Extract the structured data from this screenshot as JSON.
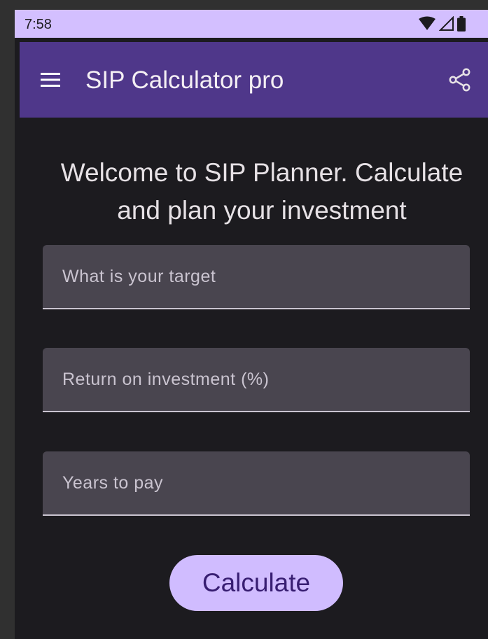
{
  "status_bar": {
    "time": "7:58",
    "icons": [
      "wifi-icon",
      "cellular-signal-icon",
      "battery-icon"
    ],
    "background": "#d3bfff"
  },
  "app_bar": {
    "title": "SIP Calculator pro",
    "menu_icon": "menu-icon",
    "share_icon": "share-icon",
    "background": "#4f378a"
  },
  "main": {
    "welcome_text": "Welcome to SIP Planner. Calculate and plan your investment",
    "fields": {
      "target": {
        "placeholder": "What is your target",
        "value": ""
      },
      "return": {
        "placeholder": "Return on investment (%)",
        "value": ""
      },
      "years": {
        "placeholder": "Years to pay",
        "value": ""
      }
    },
    "calculate_label": "Calculate"
  },
  "colors": {
    "surface": "#1c1b1f",
    "field_fill": "#49454f",
    "primary_container": "#d0bcff",
    "on_primary_container": "#381e72"
  }
}
